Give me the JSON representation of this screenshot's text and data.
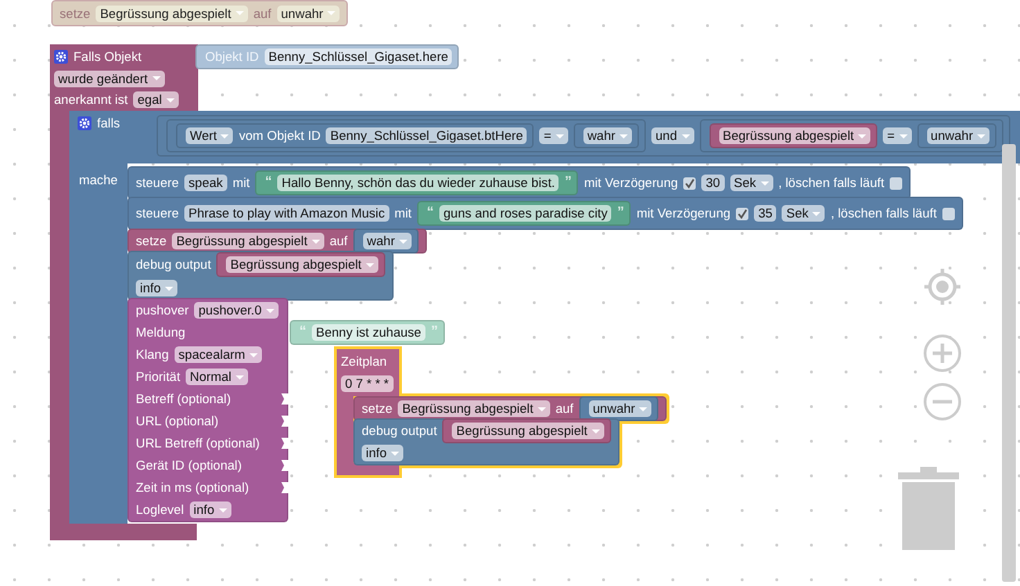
{
  "workspace": {
    "blocks": [
      {
        "kind": "set_variable",
        "disabled": true,
        "selected": false,
        "rows": [
          [
            {
              "kind": "label",
              "text": "setze"
            },
            {
              "kind": "dropdown",
              "text": "Begrüssung abgespielt"
            },
            {
              "kind": "label",
              "text": "auf"
            },
            {
              "kind": "dropdown",
              "text": "unwahr"
            }
          ]
        ]
      },
      {
        "kind": "event",
        "disabled": false,
        "selected": false,
        "rows": [
          [
            {
              "kind": "gear"
            },
            {
              "kind": "label",
              "text": "Falls Objekt"
            }
          ],
          [
            {
              "kind": "dropdown",
              "text": "wurde geändert"
            }
          ],
          [
            {
              "kind": "label",
              "text": "anerkannt ist"
            },
            {
              "kind": "dropdown",
              "text": "egal"
            }
          ]
        ],
        "input": {
          "kind": "object",
          "shadow": true,
          "parts": [
            {
              "kind": "label",
              "text": "Objekt ID"
            },
            {
              "kind": "field",
              "text": "Benny_Schlüssel_Gigaset.here"
            }
          ]
        },
        "children": [
          {
            "kind": "if",
            "rows": [
              [
                {
                  "kind": "gear"
                },
                {
                  "kind": "label",
                  "text": "falls"
                }
              ]
            ],
            "do_label": "mache",
            "input": {
              "kind": "logic",
              "shadow": false,
              "parts": [
                {
                  "kind": "logic",
                  "shadow": false,
                  "parts": [
                    {
                      "kind": "object",
                      "shadow": false,
                      "parts": [
                        {
                          "kind": "dropdown",
                          "text": "Wert"
                        },
                        {
                          "kind": "label",
                          "text": "vom Objekt ID"
                        },
                        {
                          "kind": "field",
                          "text": "Benny_Schlüssel_Gigaset.btHere"
                        }
                      ]
                    },
                    {
                      "kind": "dropdown",
                      "text": "="
                    },
                    {
                      "kind": "logic",
                      "shadow": false,
                      "parts": [
                        {
                          "kind": "dropdown",
                          "text": "wahr"
                        }
                      ]
                    }
                  ]
                },
                {
                  "kind": "dropdown",
                  "text": "und"
                },
                {
                  "kind": "logic",
                  "shadow": false,
                  "parts": [
                    {
                      "kind": "variable",
                      "shadow": false,
                      "parts": [
                        {
                          "kind": "dropdown",
                          "text": "Begrüssung abgespielt"
                        }
                      ]
                    },
                    {
                      "kind": "dropdown",
                      "text": "="
                    },
                    {
                      "kind": "logic",
                      "shadow": false,
                      "parts": [
                        {
                          "kind": "dropdown",
                          "text": "unwahr"
                        }
                      ]
                    }
                  ]
                }
              ]
            },
            "children": [
              {
                "kind": "control",
                "rows": [
                  [
                    {
                      "kind": "label",
                      "text": "steuere"
                    },
                    {
                      "kind": "field",
                      "text": "speak"
                    },
                    {
                      "kind": "label",
                      "text": "mit"
                    },
                    {
                      "kind": "text",
                      "shadow": false,
                      "parts": [
                        {
                          "kind": "quote",
                          "text": "“"
                        },
                        {
                          "kind": "field",
                          "text": "Hallo Benny, schön das du wieder zuhause bist."
                        },
                        {
                          "kind": "quote",
                          "text": "”"
                        }
                      ]
                    },
                    {
                      "kind": "label",
                      "text": "mit Verzögerung"
                    },
                    {
                      "kind": "checkbox",
                      "checked": true
                    },
                    {
                      "kind": "field",
                      "text": "30"
                    },
                    {
                      "kind": "dropdown",
                      "text": "Sek"
                    },
                    {
                      "kind": "label",
                      "text": ", löschen falls läuft"
                    },
                    {
                      "kind": "checkbox",
                      "checked": false
                    }
                  ]
                ]
              },
              {
                "kind": "control",
                "rows": [
                  [
                    {
                      "kind": "label",
                      "text": "steuere"
                    },
                    {
                      "kind": "field",
                      "text": "Phrase to play with Amazon Music"
                    },
                    {
                      "kind": "label",
                      "text": "mit"
                    },
                    {
                      "kind": "text",
                      "shadow": false,
                      "parts": [
                        {
                          "kind": "quote",
                          "text": "“"
                        },
                        {
                          "kind": "field",
                          "text": "guns and roses paradise city"
                        },
                        {
                          "kind": "quote",
                          "text": "”"
                        }
                      ]
                    },
                    {
                      "kind": "label",
                      "text": "mit Verzögerung"
                    },
                    {
                      "kind": "checkbox",
                      "checked": true
                    },
                    {
                      "kind": "field",
                      "text": "35"
                    },
                    {
                      "kind": "dropdown",
                      "text": "Sek"
                    },
                    {
                      "kind": "label",
                      "text": ", löschen falls läuft"
                    },
                    {
                      "kind": "checkbox",
                      "checked": false
                    }
                  ]
                ]
              },
              {
                "kind": "set_variable",
                "rows": [
                  [
                    {
                      "kind": "label",
                      "text": "setze"
                    },
                    {
                      "kind": "dropdown",
                      "text": "Begrüssung abgespielt"
                    },
                    {
                      "kind": "label",
                      "text": "auf"
                    },
                    {
                      "kind": "logic",
                      "shadow": false,
                      "parts": [
                        {
                          "kind": "dropdown",
                          "text": "wahr"
                        }
                      ]
                    }
                  ]
                ]
              },
              {
                "kind": "debug",
                "rows": [
                  [
                    {
                      "kind": "label",
                      "text": "debug output"
                    },
                    {
                      "kind": "variable",
                      "shadow": false,
                      "parts": [
                        {
                          "kind": "dropdown",
                          "text": "Begrüssung abgespielt"
                        }
                      ]
                    }
                  ],
                  [
                    {
                      "kind": "dropdown",
                      "text": "info"
                    }
                  ]
                ]
              },
              {
                "kind": "pushover",
                "rows": [
                  [
                    {
                      "kind": "label",
                      "text": "pushover"
                    },
                    {
                      "kind": "dropdown",
                      "text": "pushover.0"
                    }
                  ],
                  [
                    {
                      "kind": "label",
                      "text": "Meldung"
                    }
                  ],
                  [
                    {
                      "kind": "label",
                      "text": "Klang"
                    },
                    {
                      "kind": "dropdown",
                      "text": "spacealarm"
                    }
                  ],
                  [
                    {
                      "kind": "label",
                      "text": "Priorität"
                    },
                    {
                      "kind": "dropdown",
                      "text": "Normal"
                    }
                  ],
                  [
                    {
                      "kind": "label",
                      "text": "Betreff (optional)"
                    },
                    {
                      "kind": "socket"
                    }
                  ],
                  [
                    {
                      "kind": "label",
                      "text": "URL (optional)"
                    },
                    {
                      "kind": "socket"
                    }
                  ],
                  [
                    {
                      "kind": "label",
                      "text": "URL Betreff (optional)"
                    },
                    {
                      "kind": "socket"
                    }
                  ],
                  [
                    {
                      "kind": "label",
                      "text": "Gerät ID (optional)"
                    },
                    {
                      "kind": "socket"
                    }
                  ],
                  [
                    {
                      "kind": "label",
                      "text": "Zeit in ms (optional)"
                    },
                    {
                      "kind": "socket"
                    }
                  ],
                  [
                    {
                      "kind": "label",
                      "text": "Loglevel"
                    },
                    {
                      "kind": "dropdown",
                      "text": "info"
                    }
                  ]
                ],
                "input": {
                  "kind": "text",
                  "shadow": true,
                  "parts": [
                    {
                      "kind": "quote",
                      "text": "“"
                    },
                    {
                      "kind": "field",
                      "text": "Benny ist zuhause"
                    },
                    {
                      "kind": "quote",
                      "text": "”"
                    }
                  ]
                }
              }
            ]
          }
        ]
      },
      {
        "kind": "schedule",
        "disabled": false,
        "selected": true,
        "rows": [
          [
            {
              "kind": "label",
              "text": "Zeitplan"
            }
          ],
          [
            {
              "kind": "field",
              "text": "0 7 * * *"
            }
          ]
        ],
        "children": [
          {
            "kind": "set_variable",
            "rows": [
              [
                {
                  "kind": "label",
                  "text": "setze"
                },
                {
                  "kind": "dropdown",
                  "text": "Begrüssung abgespielt"
                },
                {
                  "kind": "label",
                  "text": "auf"
                },
                {
                  "kind": "logic",
                  "shadow": false,
                  "parts": [
                    {
                      "kind": "dropdown",
                      "text": "unwahr"
                    }
                  ]
                }
              ]
            ]
          },
          {
            "kind": "debug",
            "rows": [
              [
                {
                  "kind": "label",
                  "text": "debug output"
                },
                {
                  "kind": "variable",
                  "shadow": false,
                  "parts": [
                    {
                      "kind": "dropdown",
                      "text": "Begrüssung abgespielt"
                    }
                  ]
                }
              ],
              [
                {
                  "kind": "dropdown",
                  "text": "info"
                }
              ]
            ]
          }
        ]
      }
    ]
  }
}
